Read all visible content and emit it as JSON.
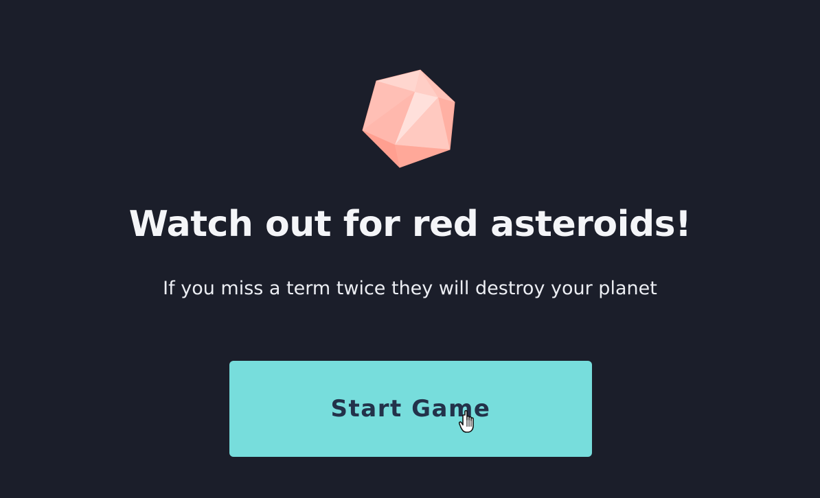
{
  "intro": {
    "title": "Watch out for red asteroids!",
    "subtitle": "If you miss a term twice they will destroy your planet",
    "start_button_label": "Start Game"
  },
  "icons": {
    "asteroid": "red-asteroid-icon",
    "cursor": "hand-pointer-cursor-icon"
  },
  "colors": {
    "background": "#1b1e2a",
    "title_text": "#f4f5f8",
    "button": "#77dddc",
    "button_text": "#23324a",
    "asteroid": "#ffb3a7"
  }
}
